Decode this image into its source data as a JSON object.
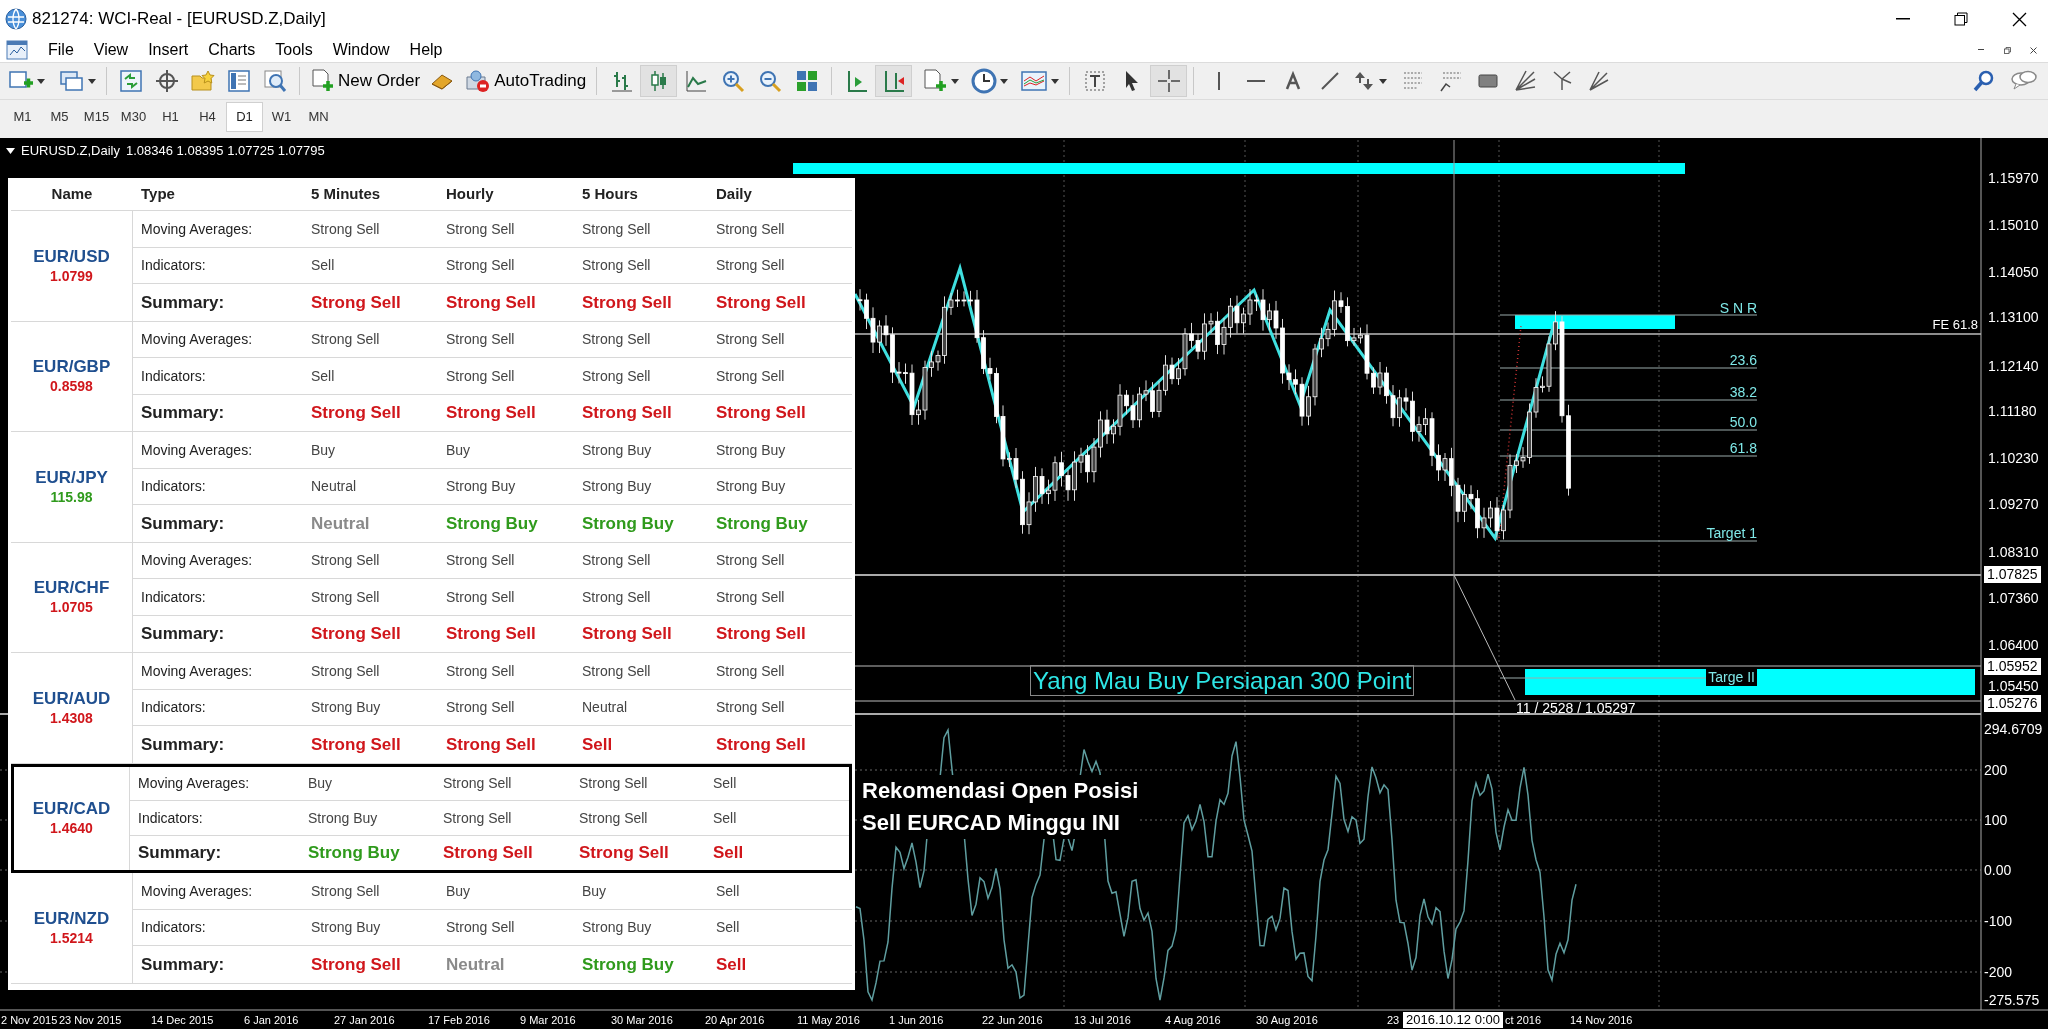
{
  "window": {
    "title": "821274: WCI-Real - [EURUSD.Z,Daily]"
  },
  "menu": [
    "File",
    "View",
    "Insert",
    "Charts",
    "Tools",
    "Window",
    "Help"
  ],
  "toolbar": {
    "new_order": "New Order",
    "auto_trading": "AutoTrading"
  },
  "timeframes": [
    {
      "label": "M1",
      "selected": false
    },
    {
      "label": "M5",
      "selected": false
    },
    {
      "label": "M15",
      "selected": false
    },
    {
      "label": "M30",
      "selected": false
    },
    {
      "label": "H1",
      "selected": false
    },
    {
      "label": "H4",
      "selected": false
    },
    {
      "label": "D1",
      "selected": true
    },
    {
      "label": "W1",
      "selected": false
    },
    {
      "label": "MN",
      "selected": false
    }
  ],
  "chart": {
    "symbol": "EURUSD.Z,Daily",
    "ohlc": "1.08346 1.08395 1.07725 1.07795",
    "price_labels": [
      "1.15970",
      "1.15010",
      "1.14050",
      "1.13100",
      "1.12140",
      "1.11180",
      "1.10230",
      "1.09270",
      "1.08310",
      "1.07360",
      "1.06400",
      "1.05450"
    ],
    "price_markers": [
      "1.07825",
      "1.05952",
      "1.05276"
    ],
    "indicator_labels": [
      "294.6709",
      "200",
      "100",
      "0.00",
      "-100",
      "-200",
      "-275.575"
    ],
    "time_labels": [
      "2 Nov 2015",
      "23 Nov 2015",
      "14 Dec 2015",
      "6 Jan 2016",
      "27 Jan 2016",
      "17 Feb 2016",
      "9 Mar 2016",
      "30 Mar 2016",
      "20 Apr 2016",
      "11 May 2016",
      "1 Jun 2016",
      "22 Jun 2016",
      "13 Jul 2016",
      "4 Aug 2016",
      "30 Aug 2016",
      "23",
      "ct 2016",
      "14 Nov 2016"
    ],
    "crosshair_time": "2016.10.12 0:00",
    "crosshair_readout": "11 / 2528 / 1.05297",
    "level_labels": [
      "S N R",
      "FE 61.8",
      "23.6",
      "38.2",
      "50.0",
      "61.8",
      "Target 1",
      "Targe II"
    ],
    "note": "Yang Mau Buy Persiapan 300 Point",
    "callout": [
      "Rekomendasi Open Posisi",
      "Sell EURCAD Minggu INI"
    ]
  },
  "table": {
    "columns": [
      "Name",
      "Type",
      "5 Minutes",
      "Hourly",
      "5 Hours",
      "Daily"
    ],
    "pairs": [
      {
        "name": "EUR/USD",
        "price": "1.0799",
        "color": "#d0161b",
        "highlighted": false,
        "rows": [
          {
            "kind": "detail",
            "type": "Moving Averages:",
            "values": [
              "Strong Sell",
              "Strong Sell",
              "Strong Sell",
              "Strong Sell"
            ]
          },
          {
            "kind": "detail",
            "type": "Indicators:",
            "values": [
              "Sell",
              "Strong Sell",
              "Strong Sell",
              "Strong Sell"
            ]
          },
          {
            "kind": "summary",
            "type": "Summary:",
            "values": [
              {
                "text": "Strong Sell",
                "color": "#d0161b"
              },
              {
                "text": "Strong Sell",
                "color": "#d0161b"
              },
              {
                "text": "Strong Sell",
                "color": "#d0161b"
              },
              {
                "text": "Strong Sell",
                "color": "#d0161b"
              }
            ]
          }
        ]
      },
      {
        "name": "EUR/GBP",
        "price": "0.8598",
        "color": "#d0161b",
        "highlighted": false,
        "rows": [
          {
            "kind": "detail",
            "type": "Moving Averages:",
            "values": [
              "Strong Sell",
              "Strong Sell",
              "Strong Sell",
              "Strong Sell"
            ]
          },
          {
            "kind": "detail",
            "type": "Indicators:",
            "values": [
              "Sell",
              "Strong Sell",
              "Strong Sell",
              "Strong Sell"
            ]
          },
          {
            "kind": "summary",
            "type": "Summary:",
            "values": [
              {
                "text": "Strong Sell",
                "color": "#d0161b"
              },
              {
                "text": "Strong Sell",
                "color": "#d0161b"
              },
              {
                "text": "Strong Sell",
                "color": "#d0161b"
              },
              {
                "text": "Strong Sell",
                "color": "#d0161b"
              }
            ]
          }
        ]
      },
      {
        "name": "EUR/JPY",
        "price": "115.98",
        "color": "#2f9a1c",
        "highlighted": false,
        "rows": [
          {
            "kind": "detail",
            "type": "Moving Averages:",
            "values": [
              "Buy",
              "Buy",
              "Strong Buy",
              "Strong Buy"
            ]
          },
          {
            "kind": "detail",
            "type": "Indicators:",
            "values": [
              "Neutral",
              "Strong Buy",
              "Strong Buy",
              "Strong Buy"
            ]
          },
          {
            "kind": "summary",
            "type": "Summary:",
            "values": [
              {
                "text": "Neutral",
                "color": "#8a8a8a"
              },
              {
                "text": "Strong Buy",
                "color": "#2f9a1c"
              },
              {
                "text": "Strong Buy",
                "color": "#2f9a1c"
              },
              {
                "text": "Strong Buy",
                "color": "#2f9a1c"
              }
            ]
          }
        ]
      },
      {
        "name": "EUR/CHF",
        "price": "1.0705",
        "color": "#d0161b",
        "highlighted": false,
        "rows": [
          {
            "kind": "detail",
            "type": "Moving Averages:",
            "values": [
              "Strong Sell",
              "Strong Sell",
              "Strong Sell",
              "Strong Sell"
            ]
          },
          {
            "kind": "detail",
            "type": "Indicators:",
            "values": [
              "Strong Sell",
              "Strong Sell",
              "Strong Sell",
              "Strong Sell"
            ]
          },
          {
            "kind": "summary",
            "type": "Summary:",
            "values": [
              {
                "text": "Strong Sell",
                "color": "#d0161b"
              },
              {
                "text": "Strong Sell",
                "color": "#d0161b"
              },
              {
                "text": "Strong Sell",
                "color": "#d0161b"
              },
              {
                "text": "Strong Sell",
                "color": "#d0161b"
              }
            ]
          }
        ]
      },
      {
        "name": "EUR/AUD",
        "price": "1.4308",
        "color": "#d0161b",
        "highlighted": false,
        "rows": [
          {
            "kind": "detail",
            "type": "Moving Averages:",
            "values": [
              "Strong Sell",
              "Strong Sell",
              "Strong Sell",
              "Strong Sell"
            ]
          },
          {
            "kind": "detail",
            "type": "Indicators:",
            "values": [
              "Strong Buy",
              "Strong Sell",
              "Neutral",
              "Strong Sell"
            ]
          },
          {
            "kind": "summary",
            "type": "Summary:",
            "values": [
              {
                "text": "Strong Sell",
                "color": "#d0161b"
              },
              {
                "text": "Strong Sell",
                "color": "#d0161b"
              },
              {
                "text": "Sell",
                "color": "#d0161b"
              },
              {
                "text": "Strong Sell",
                "color": "#d0161b"
              }
            ]
          }
        ]
      },
      {
        "name": "EUR/CAD",
        "price": "1.4640",
        "color": "#d0161b",
        "highlighted": true,
        "rows": [
          {
            "kind": "detail",
            "type": "Moving Averages:",
            "values": [
              "Buy",
              "Strong Sell",
              "Strong Sell",
              "Sell"
            ]
          },
          {
            "kind": "detail",
            "type": "Indicators:",
            "values": [
              "Strong Buy",
              "Strong Sell",
              "Strong Sell",
              "Sell"
            ]
          },
          {
            "kind": "summary",
            "type": "Summary:",
            "values": [
              {
                "text": "Strong Buy",
                "color": "#2f9a1c"
              },
              {
                "text": "Strong Sell",
                "color": "#d0161b"
              },
              {
                "text": "Strong Sell",
                "color": "#d0161b"
              },
              {
                "text": "Sell",
                "color": "#d0161b"
              }
            ]
          }
        ]
      },
      {
        "name": "EUR/NZD",
        "price": "1.5214",
        "color": "#d0161b",
        "highlighted": false,
        "rows": [
          {
            "kind": "detail",
            "type": "Moving Averages:",
            "values": [
              "Strong Sell",
              "Buy",
              "Buy",
              "Sell"
            ]
          },
          {
            "kind": "detail",
            "type": "Indicators:",
            "values": [
              "Strong Buy",
              "Strong Sell",
              "Strong Buy",
              "Sell"
            ]
          },
          {
            "kind": "summary",
            "type": "Summary:",
            "values": [
              {
                "text": "Strong Sell",
                "color": "#d0161b"
              },
              {
                "text": "Neutral",
                "color": "#8a8a8a"
              },
              {
                "text": "Strong Buy",
                "color": "#2f9a1c"
              },
              {
                "text": "Sell",
                "color": "#d0161b"
              }
            ]
          }
        ]
      }
    ]
  }
}
